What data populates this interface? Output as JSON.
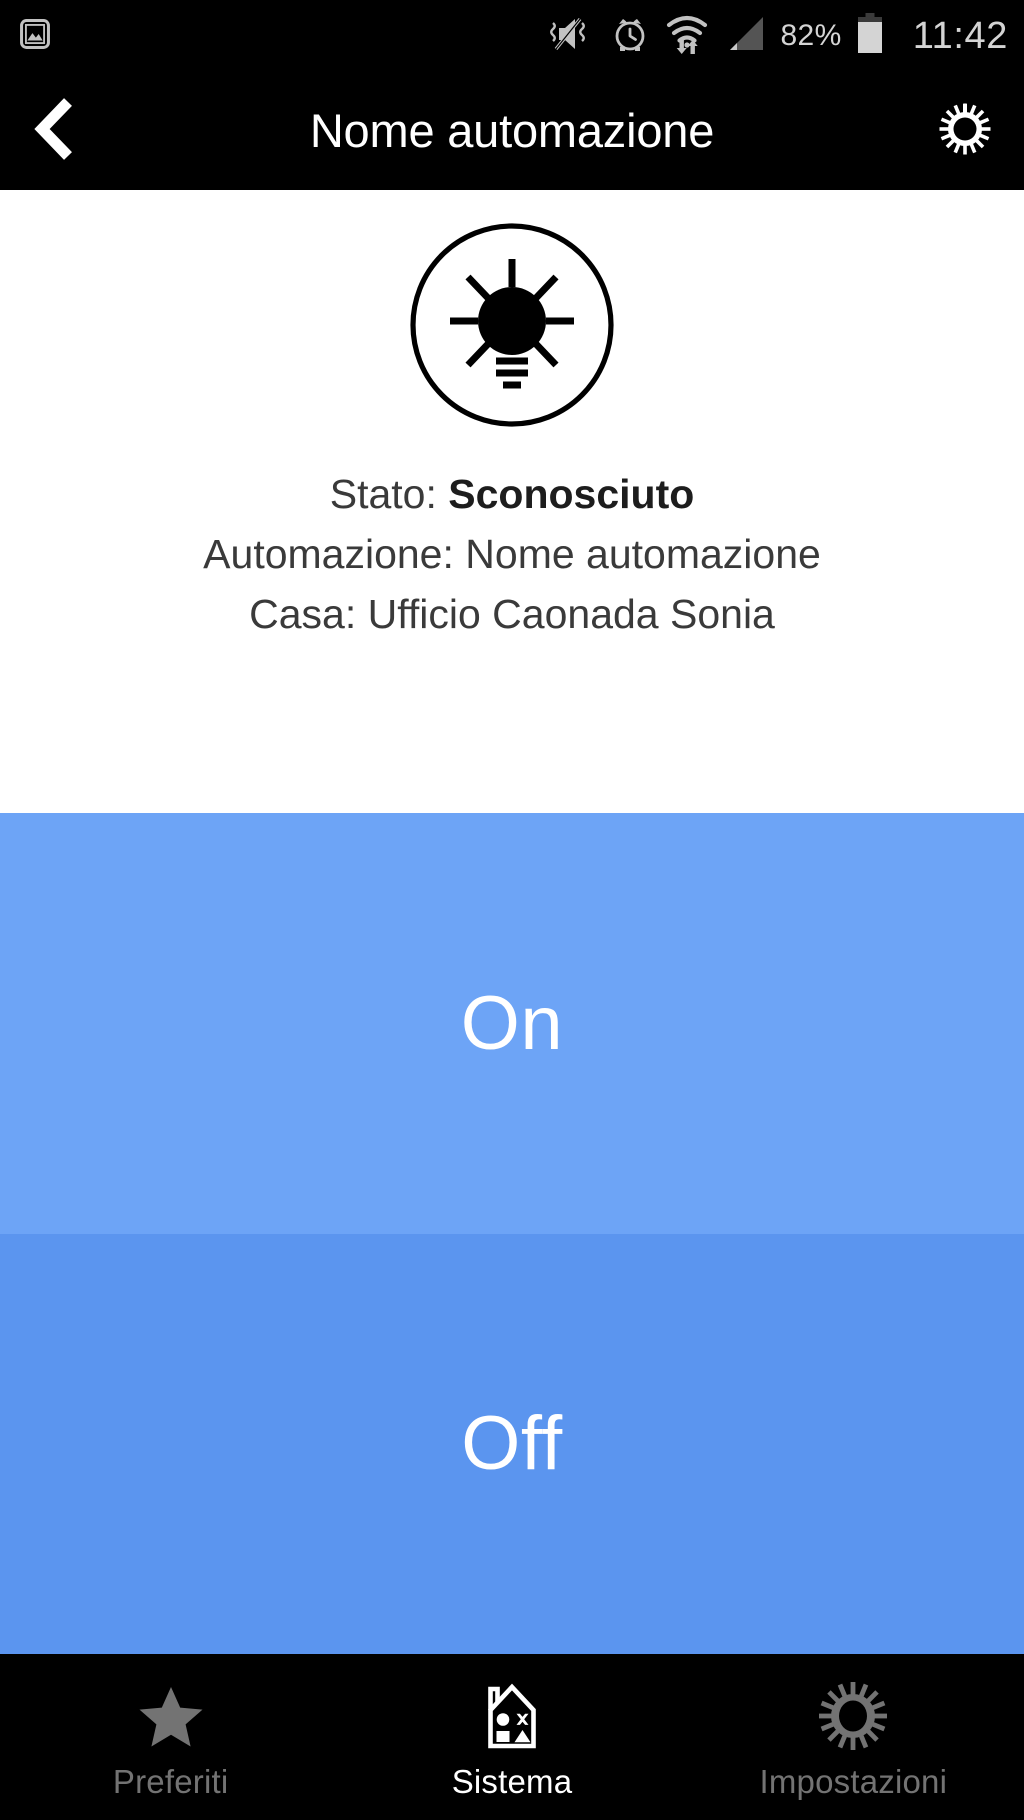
{
  "status_bar": {
    "left_icons": [
      {
        "name": "photo-icon",
        "glyph": "image"
      }
    ],
    "right_icons": [
      {
        "name": "vibrate-mute-icon",
        "glyph": "mute-vibrate"
      },
      {
        "name": "alarm-clock-icon",
        "glyph": "alarm"
      },
      {
        "name": "wifi-data-icon",
        "glyph": "wifi-transfer"
      },
      {
        "name": "cellular-signal-icon",
        "glyph": "signal-triangle"
      }
    ],
    "battery_percent": "82%",
    "clock": "11:42"
  },
  "header": {
    "back_icon": "chevron-left-icon",
    "title": "Nome automazione",
    "settings_icon": "gear-icon"
  },
  "info": {
    "device_icon": "lightbulb-icon",
    "state_label": "Stato:",
    "state_value": "Sconosciuto",
    "automation_label": "Automazione:",
    "automation_value": "Nome automazione",
    "home_label": "Casa:",
    "home_value": "Ufficio Caonada Sonia"
  },
  "controls": {
    "on_label": "On",
    "off_label": "Off",
    "on_color": "#6da4f6",
    "off_color": "#5b95ef"
  },
  "bottom_nav": {
    "items": [
      {
        "label": "Preferiti",
        "icon": "star-icon",
        "active": false
      },
      {
        "label": "Sistema",
        "icon": "house-icon",
        "active": true
      },
      {
        "label": "Impostazioni",
        "icon": "gear-icon",
        "active": false
      }
    ]
  }
}
